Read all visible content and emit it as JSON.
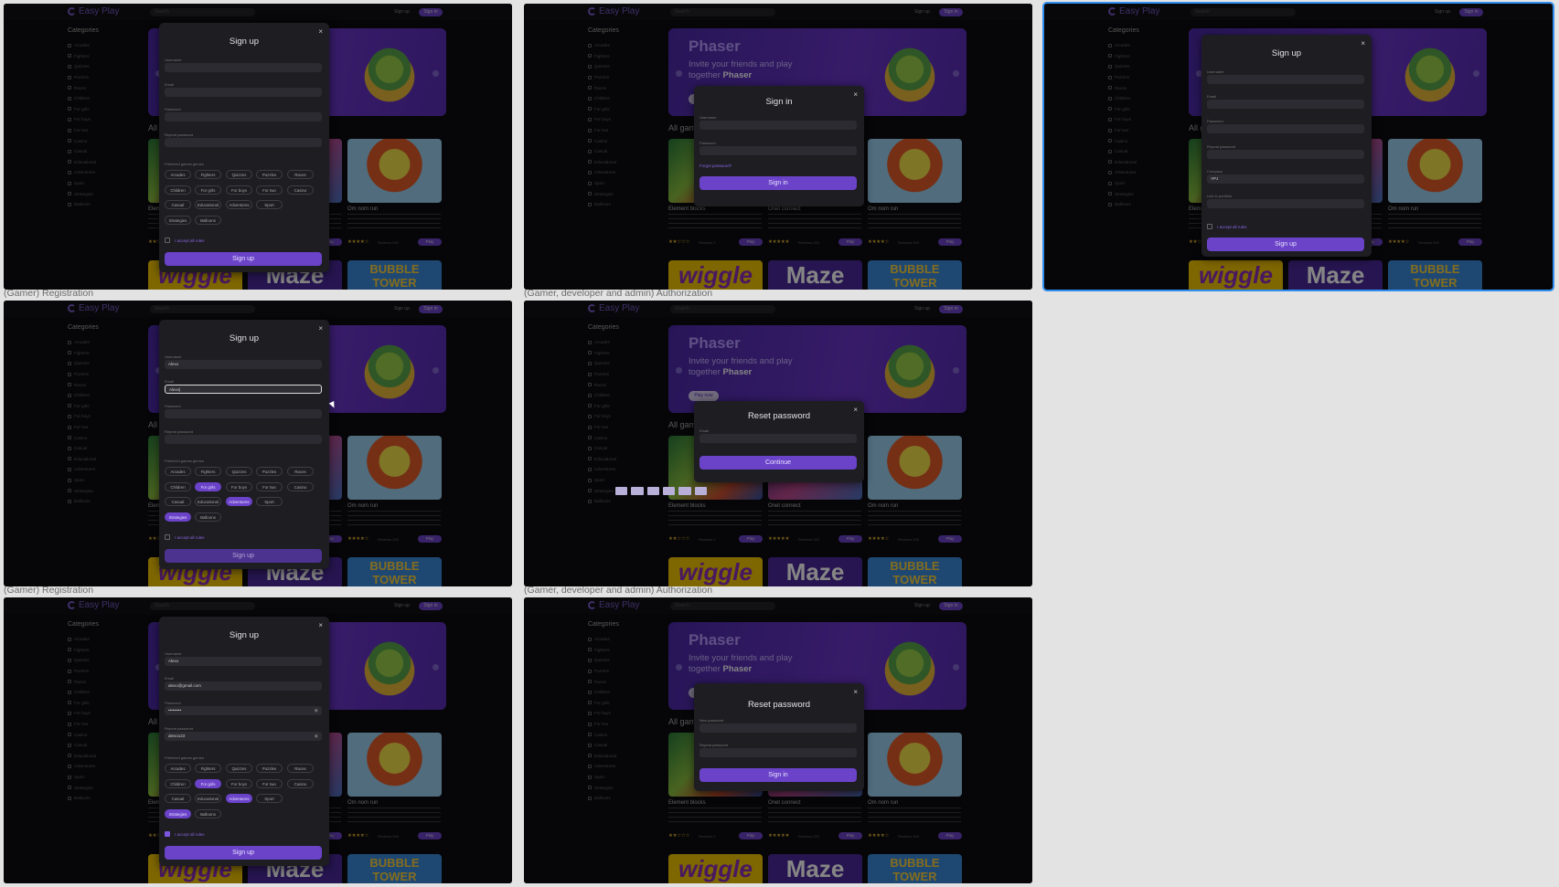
{
  "brand": {
    "name": "Easy Play"
  },
  "topbar": {
    "search_placeholder": "Search",
    "signup_link": "Sign up",
    "signin_button": "Sign in"
  },
  "sidebar": {
    "title": "Categories",
    "items": [
      "Arcades",
      "Fighters",
      "Quizzes",
      "Puzzles",
      "Races",
      "Children",
      "For girls",
      "For boys",
      "For two",
      "Casino",
      "Casual",
      "Educational",
      "Adventures",
      "Sport",
      "Strategies",
      "Balloons"
    ]
  },
  "hero": {
    "title": "Phaser",
    "subtitle_prefix": "Invite your friends and play together",
    "subtitle_brand": "Phaser",
    "button": "Play now"
  },
  "section_title": "All games",
  "games": [
    {
      "title": "Element blocks",
      "stars": "★★☆☆☆",
      "reviews": "Reviews 0",
      "play": "Play"
    },
    {
      "title": "Onet connect",
      "stars": "★★★★★",
      "reviews": "Reviews 200",
      "play": "Play"
    },
    {
      "title": "Om nom run",
      "stars": "★★★★☆",
      "reviews": "Reviews 200",
      "play": "Play"
    }
  ],
  "bottom_tiles": [
    "wiggle",
    "Maze",
    "BUBBLE TOWER"
  ],
  "captions": {
    "registration": "(Gamer) Registration",
    "authorization": "(Gamer, developer and admin) Authorization"
  },
  "signup_form": {
    "title": "Sign up",
    "close": "×",
    "labels": {
      "username": "Username",
      "email": "Email",
      "password": "Password",
      "repeat_password": "Repeat password",
      "genres": "Preferred games genres",
      "company": "Company",
      "link": "Link to portfolio"
    },
    "genre_chips": [
      "Arcades",
      "Fighters",
      "Quizzes",
      "Puzzles",
      "Races",
      "Children",
      "For girls",
      "For boys",
      "For two",
      "Casino",
      "Casual",
      "Educational",
      "Adventures",
      "Sport",
      "Strategies",
      "Balloons"
    ],
    "accept_text": "I accept all",
    "accept_link": "rules",
    "submit": "Sign up",
    "filled_username": "Alexo",
    "typing_email": "Alexo|",
    "filled_email": "alexo@gmail.com",
    "filled_password": "•••••••••",
    "filled_repeat": "alexo123",
    "company_value": "YPJ"
  },
  "signin_form": {
    "title": "Sign in",
    "close": "×",
    "username_label": "Username",
    "password_label": "Password",
    "forgot": "Forgot password?",
    "submit": "Sign in"
  },
  "reset_form": {
    "title": "Reset password",
    "close": "×",
    "email_label": "Email",
    "continue": "Continue",
    "new_password_label": "New password",
    "repeat_password_label": "Repeat password",
    "submit": "Sign in"
  },
  "colors": {
    "accent": "#6b43c9",
    "bg": "#0d0d10",
    "canvas": "#e3e3e3",
    "selection": "#2f8ef0"
  }
}
